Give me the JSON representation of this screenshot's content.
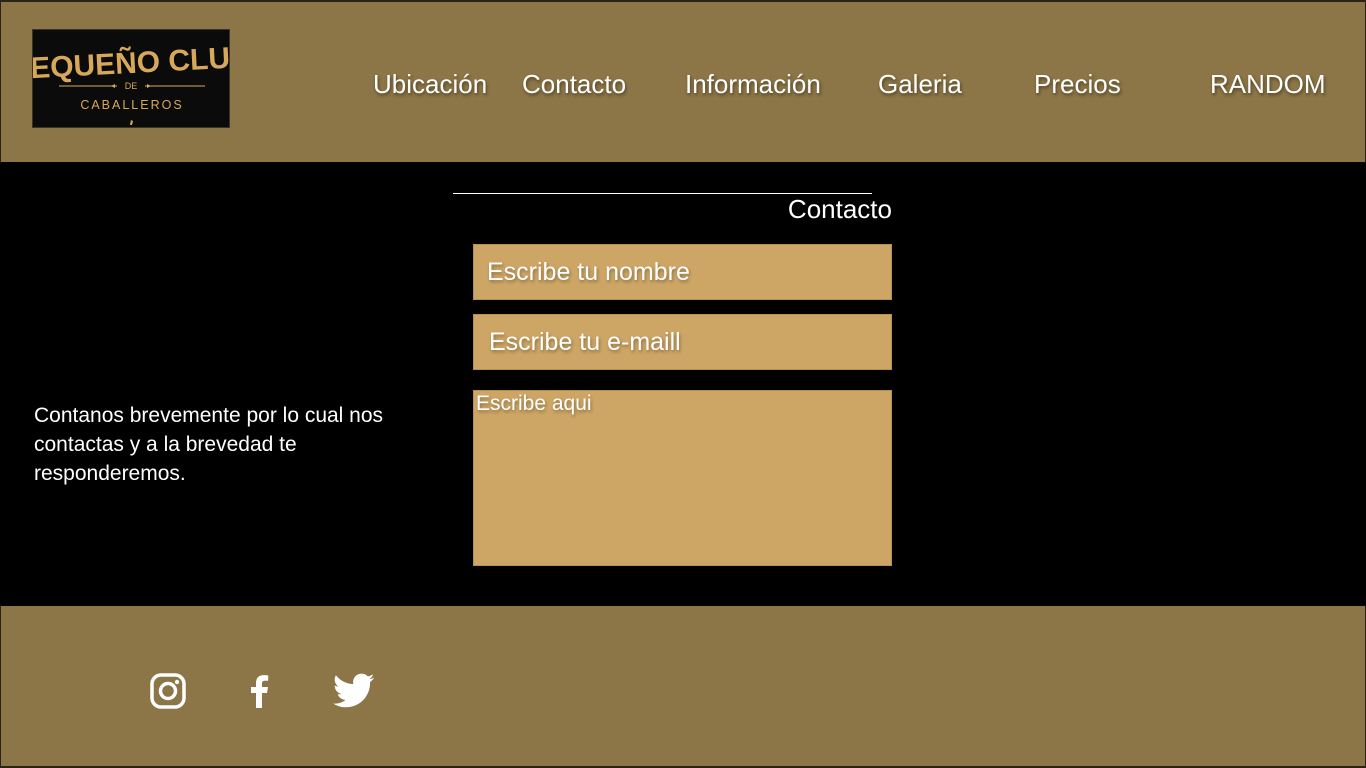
{
  "brand": {
    "logo_line1": "PEQUEÑO CLUB",
    "logo_line2": "DE",
    "logo_line3": "CABALLEROS"
  },
  "nav": {
    "items": [
      {
        "label": "Ubicación"
      },
      {
        "label": "Contacto"
      },
      {
        "label": "Información"
      },
      {
        "label": "Galeria"
      },
      {
        "label": "Precios"
      },
      {
        "label": "RANDOM"
      }
    ]
  },
  "contact": {
    "title": "Contacto",
    "intro": "Contanos brevemente por lo cual nos contactas y a la brevedad te responderemos.",
    "name_placeholder": "Escribe tu nombre",
    "email_placeholder": "Escribe tu e-maill",
    "message_placeholder": "Escribe aqui"
  },
  "footer": {
    "social": [
      {
        "icon": "instagram-icon"
      },
      {
        "icon": "facebook-icon"
      },
      {
        "icon": "twitter-icon"
      }
    ]
  },
  "colors": {
    "brand_bar": "#8c7546",
    "field_bg": "#cda665",
    "logo_gold": "#d8a85a",
    "page_bg": "#000000"
  }
}
